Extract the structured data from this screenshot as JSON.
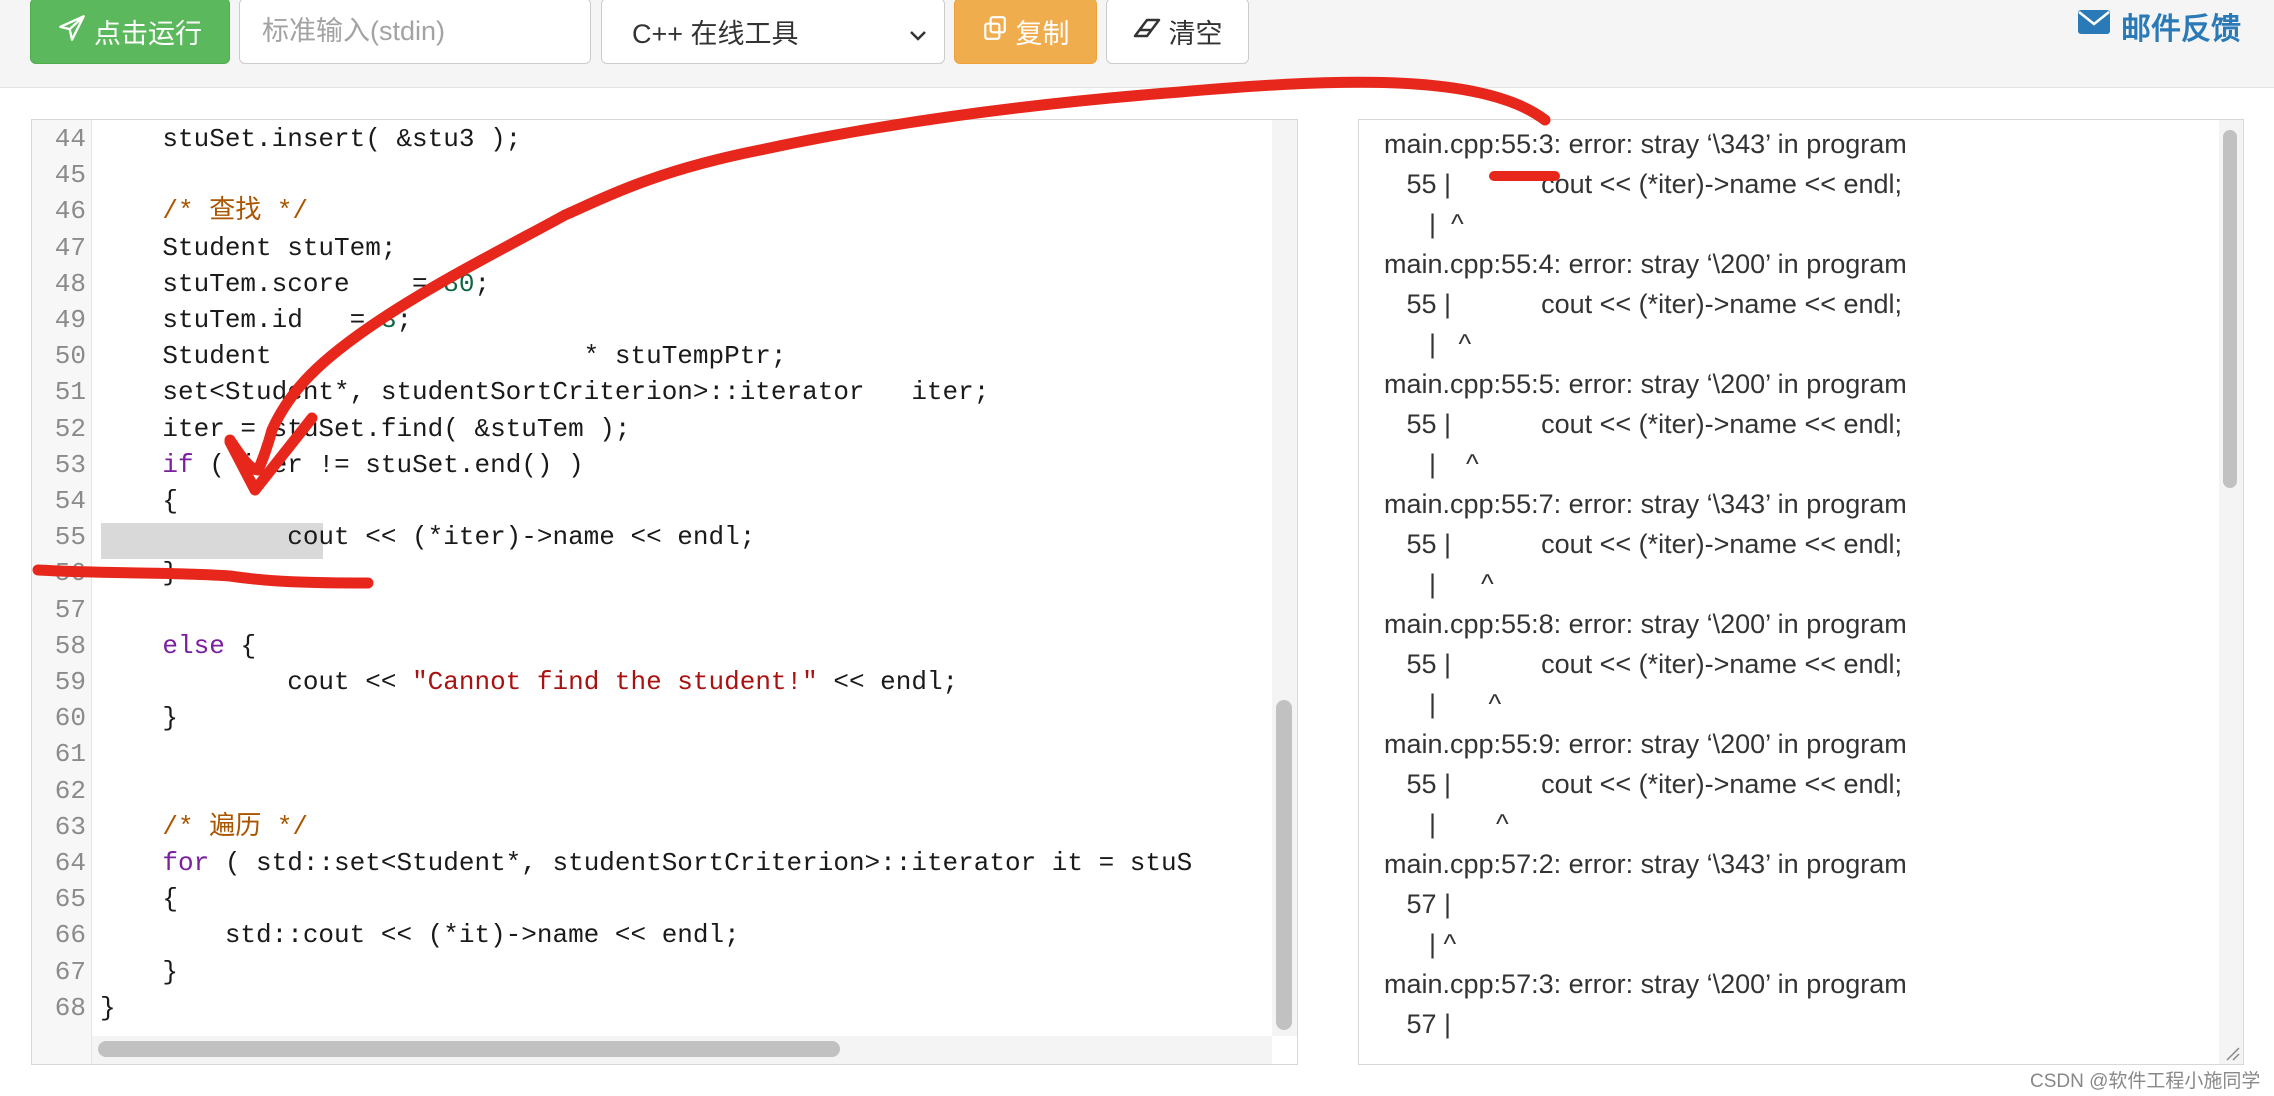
{
  "toolbar": {
    "run_label": "点击运行",
    "stdin_placeholder": "标准输入(stdin)",
    "language_selected": "C++ 在线工具",
    "copy_label": "复制",
    "clear_label": "清空",
    "feedback_label": "邮件反馈"
  },
  "editor": {
    "lines": [
      {
        "n": "44",
        "text": "    stuSet.insert( &stu3 );"
      },
      {
        "n": "45",
        "text": ""
      },
      {
        "n": "46",
        "text": "    /* 查找 */"
      },
      {
        "n": "47",
        "text": "    Student stuTem;"
      },
      {
        "n": "48",
        "text": "    stuTem.score    = 80;"
      },
      {
        "n": "49",
        "text": "    stuTem.id   = 3;"
      },
      {
        "n": "50",
        "text": "    Student                    * stuTempPtr;"
      },
      {
        "n": "51",
        "text": "    set<Student*, studentSortCriterion>::iterator   iter;"
      },
      {
        "n": "52",
        "text": "    iter = stuSet.find( &stuTem );"
      },
      {
        "n": "53",
        "text": "    if ( iter != stuSet.end() )"
      },
      {
        "n": "54",
        "text": "    {"
      },
      {
        "n": "55",
        "text": "            cout << (*iter)->name << endl;"
      },
      {
        "n": "56",
        "text": "    }"
      },
      {
        "n": "57",
        "text": ""
      },
      {
        "n": "58",
        "text": "    else {"
      },
      {
        "n": "59",
        "text": "            cout << \"Cannot find the student!\" << endl;"
      },
      {
        "n": "60",
        "text": "    }"
      },
      {
        "n": "61",
        "text": ""
      },
      {
        "n": "62",
        "text": ""
      },
      {
        "n": "63",
        "text": "    /* 遍历 */"
      },
      {
        "n": "64",
        "text": "    for ( std::set<Student*, studentSortCriterion>::iterator it = stuS"
      },
      {
        "n": "65",
        "text": "    {"
      },
      {
        "n": "66",
        "text": "        std::cout << (*it)->name << endl;"
      },
      {
        "n": "67",
        "text": "    }"
      },
      {
        "n": "68",
        "text": "}"
      }
    ]
  },
  "output": {
    "lines": [
      "main.cpp:55:3: error: stray ‘\\343’ in program",
      "   55 |            cout << (*iter)->name << endl;",
      "      |  ^",
      "main.cpp:55:4: error: stray ‘\\200’ in program",
      "   55 |            cout << (*iter)->name << endl;",
      "      |   ^",
      "main.cpp:55:5: error: stray ‘\\200’ in program",
      "   55 |            cout << (*iter)->name << endl;",
      "      |    ^",
      "main.cpp:55:7: error: stray ‘\\343’ in program",
      "   55 |            cout << (*iter)->name << endl;",
      "      |      ^",
      "main.cpp:55:8: error: stray ‘\\200’ in program",
      "   55 |            cout << (*iter)->name << endl;",
      "      |       ^",
      "main.cpp:55:9: error: stray ‘\\200’ in program",
      "   55 |            cout << (*iter)->name << endl;",
      "      |        ^",
      "main.cpp:57:2: error: stray ‘\\343’ in program",
      "   57 |",
      "      | ^",
      "main.cpp:57:3: error: stray ‘\\200’ in program",
      "   57 |"
    ]
  },
  "watermark": "CSDN @软件工程小施同学",
  "colors": {
    "run_button": "#5cb85c",
    "copy_button": "#f0ad4e",
    "feedback_link": "#2a7ab8",
    "annotation_red": "#e8271c"
  }
}
